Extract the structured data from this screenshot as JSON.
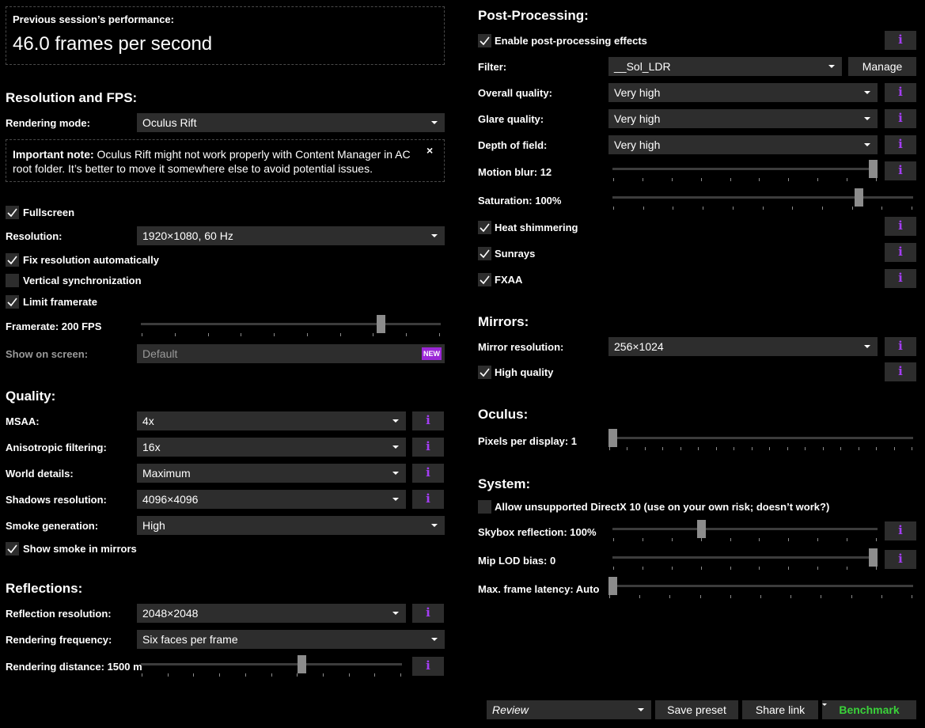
{
  "performance": {
    "label": "Previous session’s performance:",
    "value": "46.0 frames per second"
  },
  "resolution_fps": {
    "header": "Resolution and FPS:",
    "rendering_mode": {
      "label": "Rendering mode:",
      "value": "Oculus Rift"
    },
    "note": {
      "bold": "Important note:",
      "text": "Oculus Rift might not work properly with Content Manager in AC",
      "text2": "root folder. It’s better to move it somewhere else to avoid potential issues.",
      "close": "×"
    },
    "fullscreen": {
      "label": "Fullscreen",
      "checked": true
    },
    "resolution": {
      "label": "Resolution:",
      "value": "1920×1080, 60 Hz"
    },
    "fix_resolution": {
      "label": "Fix resolution automatically",
      "checked": true
    },
    "vsync": {
      "label": "Vertical synchronization",
      "checked": false
    },
    "limit_framerate": {
      "label": "Limit framerate",
      "checked": true
    },
    "framerate": {
      "label": "Framerate: 200 FPS",
      "value": 200,
      "min": 30,
      "max": 240,
      "level": 0.81
    },
    "show_on_screen": {
      "label": "Show on screen:",
      "value": "Default",
      "badge": "NEW"
    }
  },
  "quality": {
    "header": "Quality:",
    "msaa": {
      "label": "MSAA:",
      "value": "4x"
    },
    "anisotropic": {
      "label": "Anisotropic filtering:",
      "value": "16x"
    },
    "world_details": {
      "label": "World details:",
      "value": "Maximum"
    },
    "shadows": {
      "label": "Shadows resolution:",
      "value": "4096×4096"
    },
    "smoke": {
      "label": "Smoke generation:",
      "value": "High"
    },
    "smoke_mirrors": {
      "label": "Show smoke in mirrors",
      "checked": true
    }
  },
  "reflections": {
    "header": "Reflections:",
    "resolution": {
      "label": "Reflection resolution:",
      "value": "2048×2048"
    },
    "frequency": {
      "label": "Rendering frequency:",
      "value": "Six faces per frame"
    },
    "distance": {
      "label": "Rendering distance: 1500 m",
      "level": 0.62
    }
  },
  "post_processing": {
    "header": "Post-Processing:",
    "enable": {
      "label": "Enable post-processing effects",
      "checked": true
    },
    "filter": {
      "label": "Filter:",
      "value": "__Sol_LDR",
      "manage": "Manage"
    },
    "overall": {
      "label": "Overall quality:",
      "value": "Very high"
    },
    "glare": {
      "label": "Glare quality:",
      "value": "Very high"
    },
    "dof": {
      "label": "Depth of field:",
      "value": "Very high"
    },
    "motion_blur": {
      "label": "Motion blur: 12",
      "level": 1.0
    },
    "saturation": {
      "label": "Saturation: 100%",
      "level": 0.83
    },
    "heat": {
      "label": "Heat shimmering",
      "checked": true
    },
    "sunrays": {
      "label": "Sunrays",
      "checked": true
    },
    "fxaa": {
      "label": "FXAA",
      "checked": true
    }
  },
  "mirrors": {
    "header": "Mirrors:",
    "resolution": {
      "label": "Mirror resolution:",
      "value": "256×1024"
    },
    "high_quality": {
      "label": "High quality",
      "checked": true
    }
  },
  "oculus": {
    "header": "Oculus:",
    "pixels": {
      "label": "Pixels per display: 1",
      "level": 0.0
    }
  },
  "system": {
    "header": "System:",
    "dx10": {
      "label": "Allow unsupported DirectX 10 (use on your own risk; doesn’t work?)",
      "checked": false
    },
    "skybox": {
      "label": "Skybox reflection: 100%",
      "level": 0.33
    },
    "mip_lod": {
      "label": "Mip LOD bias: 0",
      "level": 1.0
    },
    "frame_latency": {
      "label": "Max. frame latency: Auto",
      "level": 0.0
    }
  },
  "footer": {
    "preset": "Review",
    "save": "Save preset",
    "share": "Share link",
    "benchmark": "Benchmark"
  },
  "colors": {
    "accent": "#a43ef5",
    "benchmark": "#3ad23a",
    "control_bg": "#2d2d2d",
    "badge": "#9b27d6"
  }
}
